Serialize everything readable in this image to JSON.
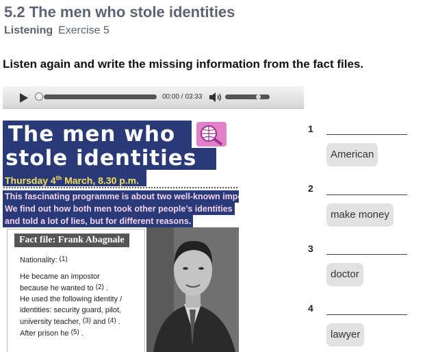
{
  "header": {
    "title": "5.2 The men who stole identities",
    "section": "Listening",
    "exercise": "Exercise 5"
  },
  "instruction": "Listen again and write the missing information from the fact files.",
  "player": {
    "time": "00:00 / 03:33",
    "progress": 0,
    "volume": 0.7
  },
  "article": {
    "headline_line1": "The men who",
    "headline_line2": "stole identities",
    "date_prefix": "Thursday 4",
    "date_sup": "th",
    "date_suffix": " March, 8.30 p.m.",
    "intro_lines": [
      "This fascinating programme is about two well-known impostors.",
      "We find out how both men took other people’s identities",
      "and told a lot of lies, but for different reasons."
    ],
    "factfile": {
      "title": "Fact file: Frank Abagnale",
      "nationality_label": "Nationality:",
      "n1": "(1)",
      "line2": "He became an impostor",
      "line3_pre": "because he wanted to",
      "n2": "(2)",
      "line4": "He used the following identity /",
      "line5": "identities: security guard, pilot,",
      "line6_pre": "university teacher,",
      "n3": "(3)",
      "and": "and",
      "n4": "(4)",
      "line7_pre": "After prison he",
      "n5": "(5)"
    }
  },
  "answers": [
    {
      "number": "1",
      "option": "American"
    },
    {
      "number": "2",
      "option": "make money"
    },
    {
      "number": "3",
      "option": "doctor"
    },
    {
      "number": "4",
      "option": "lawyer"
    }
  ]
}
